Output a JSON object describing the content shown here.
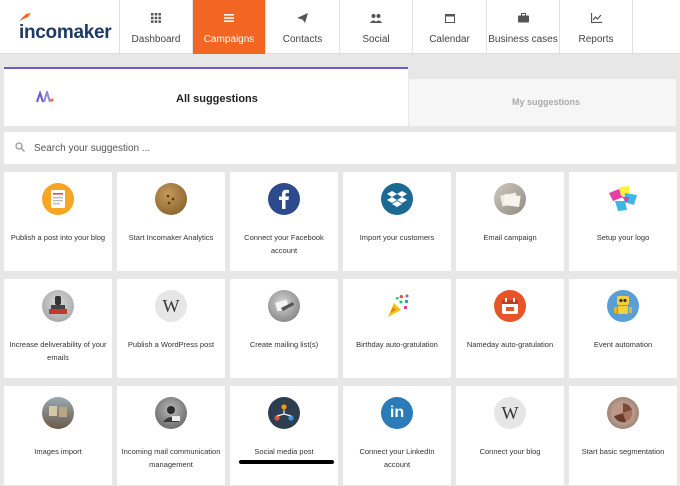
{
  "app": {
    "logo_text": "incomaker"
  },
  "nav": {
    "items": [
      {
        "label": "Dashboard",
        "icon": "grid-icon"
      },
      {
        "label": "Campaigns",
        "icon": "list-icon",
        "active": true
      },
      {
        "label": "Contacts",
        "icon": "paper-plane-icon"
      },
      {
        "label": "Social",
        "icon": "people-icon"
      },
      {
        "label": "Calendar",
        "icon": "calendar-icon"
      },
      {
        "label": "Business cases",
        "icon": "briefcase-icon"
      },
      {
        "label": "Reports",
        "icon": "line-chart-icon"
      }
    ]
  },
  "tabs": {
    "all": "All suggestions",
    "my": "My suggestions"
  },
  "search": {
    "placeholder": "Search your suggestion ..."
  },
  "colors": {
    "accent": "#f26522",
    "tab_underline": "#6a5acd",
    "brand_navy": "#1d3a63"
  },
  "cards": [
    {
      "label": "Publish a post into your blog",
      "icon": "blog-post-icon"
    },
    {
      "label": "Start Incomaker Analytics",
      "icon": "analytics-icon"
    },
    {
      "label": "Connect your Facebook account",
      "icon": "facebook-icon"
    },
    {
      "label": "Import your customers",
      "icon": "dropbox-icon"
    },
    {
      "label": "Email campaign",
      "icon": "email-campaign-icon"
    },
    {
      "label": "Setup your logo",
      "icon": "logo-setup-icon"
    },
    {
      "label": "Increase deliverability of your emails",
      "icon": "stamp-icon"
    },
    {
      "label": "Publish a WordPress post",
      "icon": "wordpress-icon"
    },
    {
      "label": "Create mailing list(s)",
      "icon": "mailing-list-icon"
    },
    {
      "label": "Birthday auto-gratulation",
      "icon": "party-popper-icon"
    },
    {
      "label": "Nameday auto-gratulation",
      "icon": "calendar-date-icon"
    },
    {
      "label": "Event automation",
      "icon": "robot-icon"
    },
    {
      "label": "Images import",
      "icon": "images-icon"
    },
    {
      "label": "Incoming mail communication management",
      "icon": "mail-management-icon"
    },
    {
      "label": "Social media post",
      "icon": "social-network-icon"
    },
    {
      "label": "Connect your LinkedIn account",
      "icon": "linkedin-icon"
    },
    {
      "label": "Connect your blog",
      "icon": "wikipedia-icon"
    },
    {
      "label": "Start basic segmentation",
      "icon": "segmentation-icon"
    }
  ]
}
